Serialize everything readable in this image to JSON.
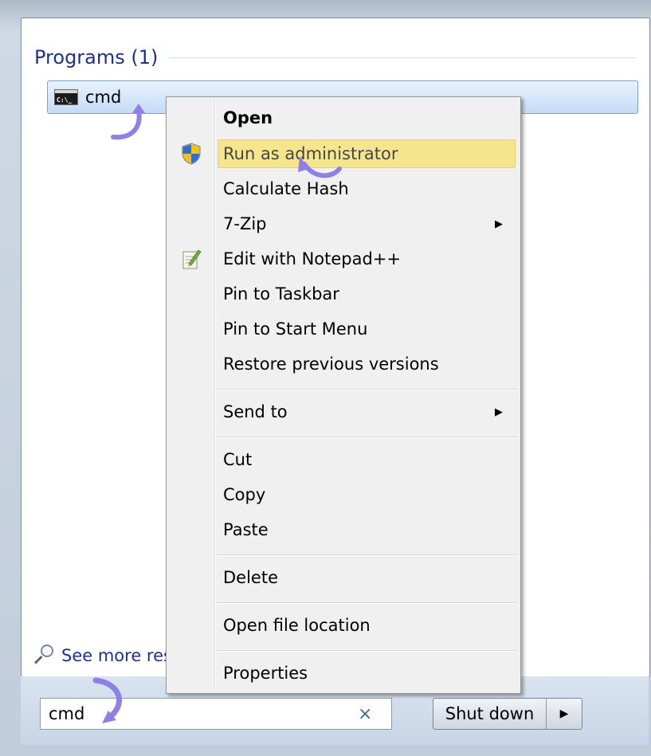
{
  "programs_section": {
    "title": "Programs (1)",
    "result": {
      "label": "cmd",
      "icon": "cmd-console-icon",
      "icon_text": "C:\\_"
    }
  },
  "context_menu": {
    "items": [
      {
        "label": "Open",
        "bold": true
      },
      {
        "label": "Run as administrator",
        "icon": "uac-shield-icon",
        "highlighted": true
      },
      {
        "label": "Calculate Hash"
      },
      {
        "label": "7-Zip",
        "submenu": true
      },
      {
        "label": "Edit with Notepad++",
        "icon": "notepad-plus-plus-icon"
      },
      {
        "label": "Pin to Taskbar"
      },
      {
        "label": "Pin to Start Menu"
      },
      {
        "label": "Restore previous versions"
      },
      {
        "label": "Send to",
        "submenu": true
      },
      {
        "label": "Cut"
      },
      {
        "label": "Copy"
      },
      {
        "label": "Paste"
      },
      {
        "label": "Delete"
      },
      {
        "label": "Open file location"
      },
      {
        "label": "Properties"
      }
    ],
    "submenu_glyph": "▶"
  },
  "see_more": {
    "label": "See more res"
  },
  "search": {
    "value": "cmd",
    "clear_glyph": "×"
  },
  "shutdown": {
    "label": "Shut down",
    "arrow_glyph": "▶"
  },
  "colors": {
    "highlight": "#f5e58c",
    "section_title": "#1e3287",
    "annotation_arrow": "#8f80e8"
  }
}
